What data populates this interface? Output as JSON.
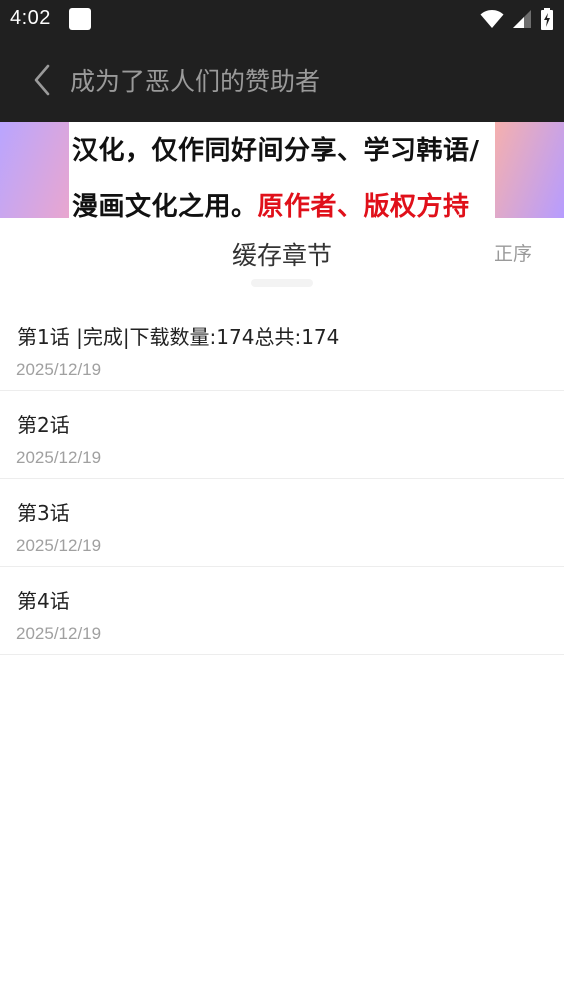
{
  "status_bar": {
    "time": "4:02",
    "icons": [
      "notification-square-icon",
      "wifi-icon",
      "cellular-signal-icon",
      "battery-charging-icon"
    ]
  },
  "app_bar": {
    "back_icon": "chevron-left-icon",
    "title": "成为了恶人们的赞助者"
  },
  "banner": {
    "line1": "汉化，仅作同好间分享、学习韩语/",
    "line2_black": "漫画文化之用。",
    "line2_red": "原作者、版权方持"
  },
  "section": {
    "title": "缓存章节",
    "sort_label": "正序"
  },
  "chapters": [
    {
      "title": "第1话 |完成|下载数量:174总共:174",
      "date": "2025/12/19"
    },
    {
      "title": "第2话",
      "date": "2025/12/19"
    },
    {
      "title": "第3话",
      "date": "2025/12/19"
    },
    {
      "title": "第4话",
      "date": "2025/12/19"
    }
  ],
  "colors": {
    "bar_background": "#202020",
    "banner_red": "#e0101a",
    "muted_text": "#9a9a9a"
  }
}
